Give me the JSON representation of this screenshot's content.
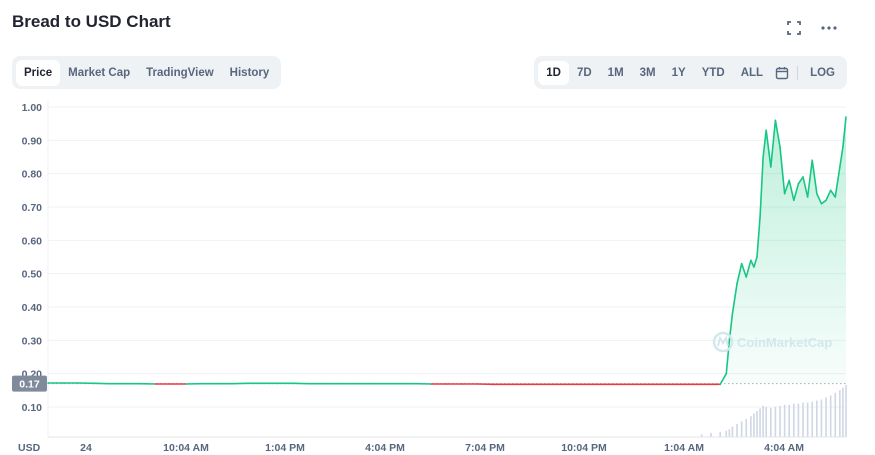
{
  "title": "Bread to USD Chart",
  "tabs": [
    "Price",
    "Market Cap",
    "TradingView",
    "History"
  ],
  "active_tab": "Price",
  "ranges": [
    "1D",
    "7D",
    "1M",
    "3M",
    "1Y",
    "YTD",
    "ALL"
  ],
  "active_range": "1D",
  "log_label": "LOG",
  "watermark": "CoinMarketCap",
  "current_price_label": "0.17",
  "currency_label": "USD",
  "colors": {
    "up": "#16c784",
    "down": "#ea3943",
    "price_tag": "#808a9d"
  },
  "chart_data": {
    "type": "area",
    "title": "Bread to USD Chart",
    "ylim": [
      0.0,
      1.0
    ],
    "yticks": [
      0.1,
      0.2,
      0.3,
      0.4,
      0.5,
      0.6,
      0.7,
      0.8,
      0.9,
      1.0
    ],
    "ytick_labels": [
      "0.10",
      "0.20",
      "0.30",
      "0.40",
      "0.50",
      "0.60",
      "0.70",
      "0.80",
      "0.90",
      "1.00"
    ],
    "xtick_labels": [
      "24",
      "10:04 AM",
      "1:04 PM",
      "4:04 PM",
      "7:04 PM",
      "10:04 PM",
      "1:04 AM",
      "4:04 AM"
    ],
    "baseline_price": 0.17,
    "grid": true,
    "series": [
      {
        "x": [
          0,
          0.5,
          1,
          1.5,
          2,
          2.5,
          3,
          3.5,
          4,
          4.5,
          5,
          5.5,
          6,
          6.5,
          7,
          7.5,
          8,
          8.5,
          9,
          9.5,
          10,
          10.5,
          11,
          11.5,
          12,
          12.5,
          13,
          13.5,
          14,
          14.5,
          15,
          15.5,
          16,
          16.5,
          17,
          17.5,
          18,
          18.5,
          19,
          19.5,
          20,
          20.5,
          21,
          21.3,
          21.6,
          21.9,
          22.1,
          22.2,
          22.3,
          22.45,
          22.6,
          22.75,
          22.9,
          23.0,
          23.1,
          23.2,
          23.3,
          23.4,
          23.55,
          23.7,
          23.85,
          24.0,
          24.15,
          24.3,
          24.45,
          24.6,
          24.75,
          24.9,
          25.05,
          25.2,
          25.35,
          25.5,
          25.65,
          25.8,
          25.9,
          26.0
        ],
        "y": [
          0.172,
          0.172,
          0.172,
          0.171,
          0.17,
          0.17,
          0.17,
          0.169,
          0.169,
          0.169,
          0.17,
          0.17,
          0.17,
          0.171,
          0.171,
          0.171,
          0.171,
          0.17,
          0.17,
          0.17,
          0.17,
          0.17,
          0.17,
          0.17,
          0.17,
          0.169,
          0.169,
          0.169,
          0.169,
          0.168,
          0.168,
          0.168,
          0.168,
          0.168,
          0.168,
          0.168,
          0.168,
          0.168,
          0.168,
          0.168,
          0.168,
          0.168,
          0.168,
          0.168,
          0.168,
          0.168,
          0.2,
          0.3,
          0.38,
          0.47,
          0.53,
          0.49,
          0.54,
          0.52,
          0.55,
          0.67,
          0.85,
          0.93,
          0.82,
          0.96,
          0.88,
          0.74,
          0.78,
          0.72,
          0.77,
          0.79,
          0.73,
          0.84,
          0.74,
          0.71,
          0.72,
          0.75,
          0.73,
          0.82,
          0.88,
          0.97
        ]
      }
    ],
    "volume": [
      0,
      0,
      0,
      0,
      0,
      0,
      0,
      0,
      0,
      0,
      0,
      0,
      0,
      0,
      0,
      0,
      0,
      0,
      0,
      0,
      0,
      0,
      0,
      0,
      0,
      0,
      0,
      0,
      0,
      0,
      0,
      0,
      0,
      0,
      0,
      0,
      0,
      0,
      0,
      0,
      0,
      0,
      0,
      0.05,
      0.08,
      0.1,
      0.12,
      0.15,
      0.2,
      0.25,
      0.3,
      0.35,
      0.4,
      0.45,
      0.5,
      0.55,
      0.6,
      0.58,
      0.56,
      0.58,
      0.6,
      0.62,
      0.62,
      0.64,
      0.64,
      0.66,
      0.66,
      0.68,
      0.7,
      0.72,
      0.76,
      0.8,
      0.85,
      0.9,
      0.95,
      1.0
    ]
  }
}
